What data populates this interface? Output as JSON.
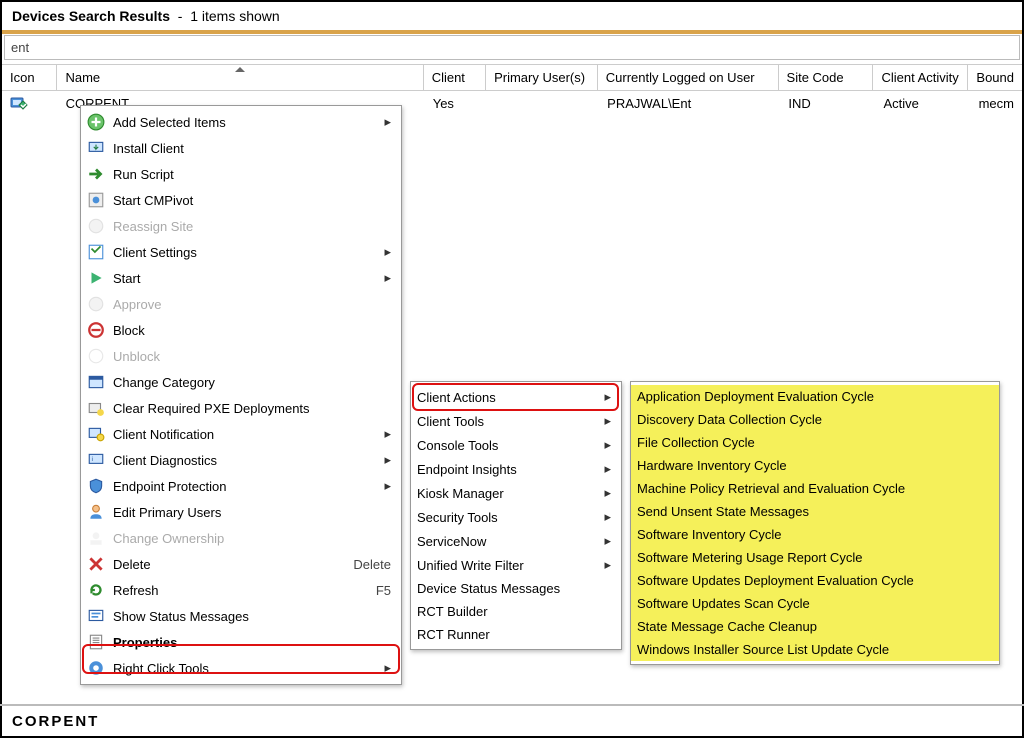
{
  "header": {
    "title": "Devices Search Results",
    "subtitle": "1 items shown"
  },
  "search": {
    "value": "ent"
  },
  "columns": {
    "icon": "Icon",
    "name": "Name",
    "client": "Client",
    "primary": "Primary User(s)",
    "logged": "Currently Logged on User",
    "site": "Site Code",
    "activity": "Client Activity",
    "bound": "Bound"
  },
  "row": {
    "name": "CORPENT",
    "client": "Yes",
    "primary": "",
    "logged": "PRAJWAL\\Ent",
    "site": "IND",
    "activity": "Active",
    "bound": "mecm"
  },
  "menu1": {
    "add": "Add Selected Items",
    "install": "Install Client",
    "run": "Run Script",
    "cmpivot": "Start CMPivot",
    "reassign": "Reassign Site",
    "settings": "Client Settings",
    "start": "Start",
    "approve": "Approve",
    "block": "Block",
    "unblock": "Unblock",
    "category": "Change Category",
    "pxe": "Clear Required PXE Deployments",
    "notify": "Client Notification",
    "diag": "Client Diagnostics",
    "endpoint": "Endpoint Protection",
    "primary": "Edit Primary Users",
    "owner": "Change Ownership",
    "delete": "Delete",
    "delete_accel": "Delete",
    "refresh": "Refresh",
    "refresh_accel": "F5",
    "status": "Show Status Messages",
    "props": "Properties",
    "rct": "Right Click Tools"
  },
  "menu2": {
    "actions": "Client Actions",
    "tools": "Client Tools",
    "console": "Console Tools",
    "insights": "Endpoint Insights",
    "kiosk": "Kiosk Manager",
    "security": "Security Tools",
    "snow": "ServiceNow",
    "uwf": "Unified Write Filter",
    "devstatus": "Device Status Messages",
    "builder": "RCT Builder",
    "runner": "RCT Runner"
  },
  "menu3": {
    "i0": "Application Deployment Evaluation Cycle",
    "i1": "Discovery Data Collection Cycle",
    "i2": "File Collection Cycle",
    "i3": "Hardware Inventory Cycle",
    "i4": "Machine Policy Retrieval and Evaluation Cycle",
    "i5": "Send Unsent State Messages",
    "i6": "Software Inventory Cycle",
    "i7": "Software Metering Usage Report Cycle",
    "i8": "Software Updates Deployment Evaluation Cycle",
    "i9": "Software Updates Scan Cycle",
    "i10": "State Message Cache Cleanup",
    "i11": "Windows Installer Source List Update Cycle"
  },
  "footer": {
    "name": "CORPENT"
  }
}
